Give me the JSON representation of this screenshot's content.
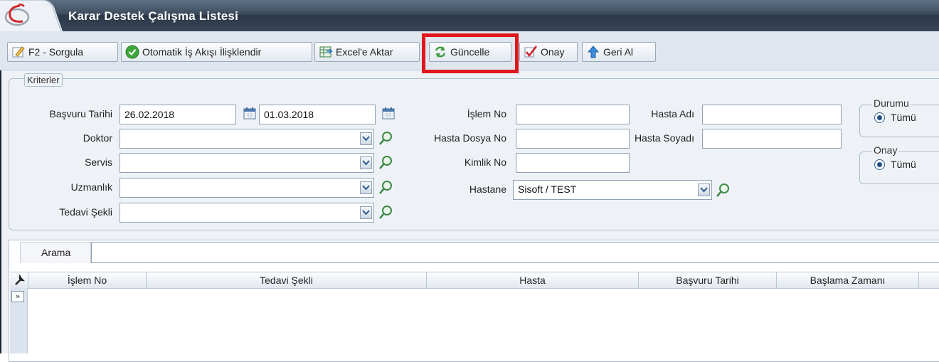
{
  "window": {
    "title": "Karar Destek Çalışma Listesi"
  },
  "toolbar": {
    "buttons": [
      {
        "label": "F2 - Sorgula",
        "icon": "edit-icon"
      },
      {
        "label": "Otomatik İş Akışı İlişklendir",
        "icon": "check-circle-icon"
      },
      {
        "label": "Excel'e Aktar",
        "icon": "excel-icon"
      },
      {
        "label": "Güncelle",
        "icon": "refresh-icon"
      },
      {
        "label": "Onay",
        "icon": "checkmark-icon"
      },
      {
        "label": "Geri Al",
        "icon": "undo-arrow-icon"
      }
    ]
  },
  "criteria": {
    "legend": "Kriterler",
    "basvuru_tarihi_label": "Başvuru Tarihi",
    "date_from": "26.02.2018",
    "date_to": "01.03.2018",
    "doktor_label": "Doktor",
    "servis_label": "Servis",
    "uzmanlik_label": "Uzmanlık",
    "tedavi_label": "Tedavi Şekli",
    "islem_no_label": "İşlem No",
    "hasta_dosya_label": "Hasta Dosya No",
    "kimlik_label": "Kimlik No",
    "hastane_label": "Hastane",
    "hastane_value": "Sisoft / TEST",
    "hasta_adi_label": "Hasta Adı",
    "hasta_soyadi_label": "Hasta Soyadı",
    "durumu_label": "Durumu",
    "durumu_value": "Tümü",
    "onay_label": "Onay",
    "onay_value": "Tümü"
  },
  "grid": {
    "search_label": "Arama",
    "columns": [
      "İşlem No",
      "Tedavi Şekli",
      "Hasta",
      "Başvuru Tarihi",
      "Başlama Zamanı"
    ],
    "expander": "»"
  },
  "colors": {
    "highlight": "#e0161b",
    "titlebar": "#3c4c5e"
  }
}
